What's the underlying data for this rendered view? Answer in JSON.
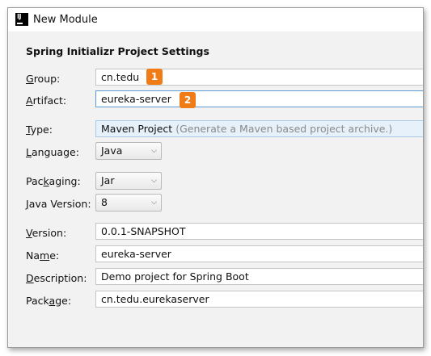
{
  "window": {
    "title": "New Module"
  },
  "section": {
    "title": "Spring Initializr Project Settings"
  },
  "fields": {
    "group": {
      "label_prefix": "",
      "label_mnemonic": "G",
      "label_rest": "roup:",
      "value": "cn.tedu"
    },
    "artifact": {
      "label_prefix": "",
      "label_mnemonic": "A",
      "label_rest": "rtifact:",
      "value": "eureka-server"
    },
    "type": {
      "label_prefix": "",
      "label_mnemonic": "T",
      "label_rest": "ype:",
      "value": "Maven Project",
      "hint": "(Generate a Maven based project archive.)"
    },
    "language": {
      "label_prefix": "",
      "label_mnemonic": "L",
      "label_rest": "anguage:",
      "value": "Java"
    },
    "packaging": {
      "label_prefix": "Pac",
      "label_mnemonic": "k",
      "label_rest": "aging:",
      "value": "Jar"
    },
    "java_version": {
      "label_prefix": "",
      "label_mnemonic": "J",
      "label_rest": "ava Version:",
      "value": "8"
    },
    "version": {
      "label_prefix": "",
      "label_mnemonic": "V",
      "label_rest": "ersion:",
      "value": "0.0.1-SNAPSHOT"
    },
    "name": {
      "label_prefix": "Na",
      "label_mnemonic": "m",
      "label_rest": "e:",
      "value": "eureka-server"
    },
    "description": {
      "label_prefix": "",
      "label_mnemonic": "D",
      "label_rest": "escription:",
      "value": "Demo project for Spring Boot"
    },
    "package": {
      "label_prefix": "Pack",
      "label_mnemonic": "a",
      "label_rest": "ge:",
      "value": "cn.tedu.eurekaserver"
    }
  },
  "annotations": {
    "badge1": "1",
    "badge2": "2"
  },
  "icons": {
    "app": "intellij-idea-icon",
    "dropdown": "chevron-down-icon"
  },
  "colors": {
    "badge": "#f07c17",
    "focus_border": "#5b9bd6",
    "type_field_bg": "#e7f1fa"
  }
}
